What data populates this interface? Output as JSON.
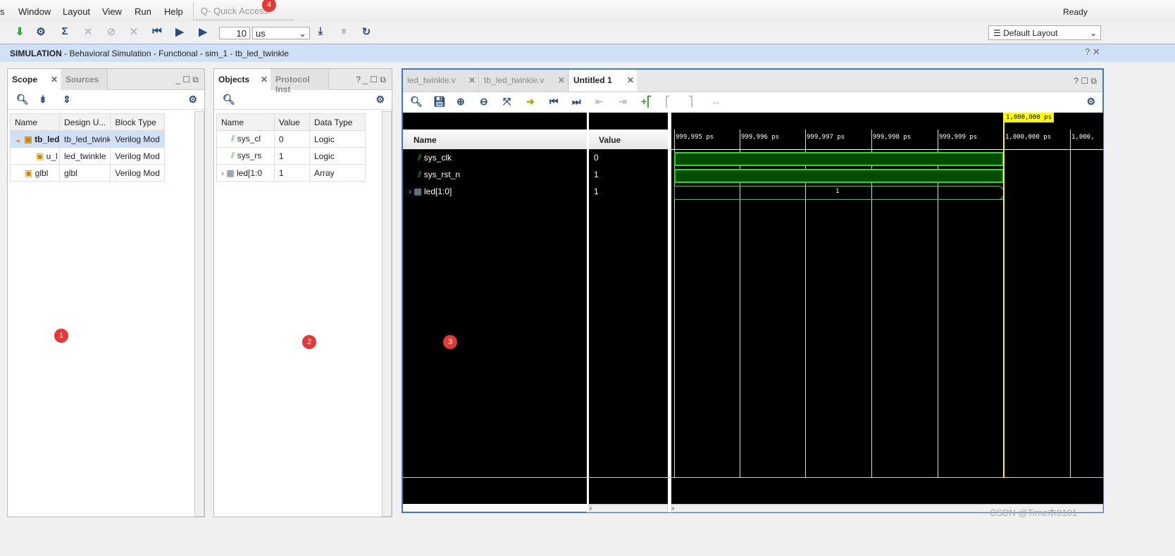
{
  "menu": {
    "items": [
      "s",
      "Window",
      "Layout",
      "View",
      "Run",
      "Help"
    ],
    "quick_access": "Q- Quick Access",
    "status": "Ready"
  },
  "toolbar": {
    "run_time_value": "10",
    "run_time_unit": "us",
    "layout": "Default Layout"
  },
  "sim_header": {
    "bold": "SIMULATION",
    "rest": " - Behavioral Simulation - Functional - sim_1 - tb_led_twinkle"
  },
  "scope": {
    "tabs": [
      "Scope",
      "Sources"
    ],
    "columns": [
      "Name",
      "Design U...",
      "Block Type"
    ],
    "rows": [
      [
        "tb_led",
        "tb_led_twink",
        "Verilog Mod"
      ],
      [
        "u_l",
        "led_twinkle",
        "Verilog Mod"
      ],
      [
        "glbl",
        "glbl",
        "Verilog Mod"
      ]
    ]
  },
  "objects": {
    "tabs": [
      "Objects",
      "Protocol Inst"
    ],
    "columns": [
      "Name",
      "Value",
      "Data Type"
    ],
    "rows": [
      [
        "sys_cl",
        "0",
        "Logic"
      ],
      [
        "sys_rs",
        "1",
        "Logic"
      ],
      [
        "led[1:0",
        "1",
        "Array"
      ]
    ]
  },
  "wave": {
    "tabs": [
      "led_twinkle.v",
      "tb_led_twinkle.v",
      "Untitled 1"
    ],
    "name_header": "Name",
    "value_header": "Value",
    "signals": [
      {
        "name": "sys_clk",
        "value": "0"
      },
      {
        "name": "sys_rst_n",
        "value": "1"
      },
      {
        "name": "led[1:0]",
        "value": "1",
        "bus_label": "1"
      }
    ],
    "ticks": [
      "999,995 ps",
      "999,996 ps",
      "999,997 ps",
      "999,998 ps",
      "999,999 ps",
      "1,000,000 ps",
      "1,000,"
    ],
    "cursor": "1,000,000 ps",
    "wave_color": "#22dd22",
    "cursor_color": "#ffff00"
  },
  "markers": [
    "1",
    "2",
    "3",
    "4"
  ],
  "watermark": "CSDN @Time木0101"
}
